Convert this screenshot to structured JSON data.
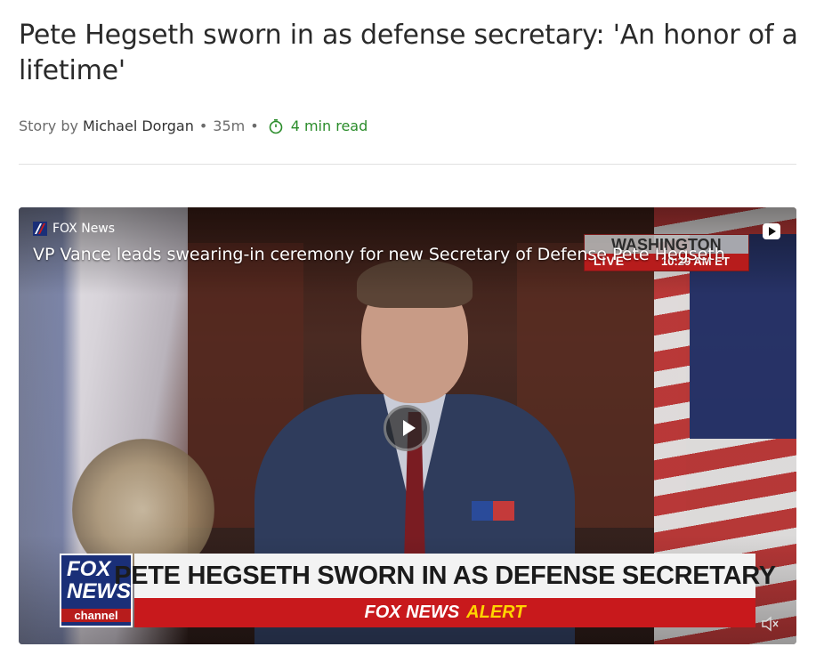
{
  "article": {
    "title": "Pete Hegseth sworn in as defense secretary: 'An honor of a lifetime'",
    "byline_prefix": "Story by",
    "author": "Michael Dorgan",
    "separator": "•",
    "age": "35m",
    "read_time": "4 min read"
  },
  "video": {
    "source": "FOX News",
    "title": "VP Vance leads swearing-in ceremony for new Secretary of Defense Pete Hegseth",
    "bug_city": "WASHINGTON",
    "bug_live": "LIVE",
    "bug_time": "10:29 AM ET",
    "logo_line1": "FOX",
    "logo_line2": "NEWS",
    "logo_line3": "channel",
    "headline": "PETE HEGSETH SWORN IN AS DEFENSE SECRETARY",
    "alert_prefix": "FOX NEWS",
    "alert_word": "ALERT",
    "colors": {
      "alert_red": "#c8191c",
      "fox_blue": "#1a2f78",
      "read_time_green": "#2a8c2a"
    },
    "icons": [
      "fox-news-logo-icon",
      "youtube-icon",
      "play-icon",
      "mute-icon"
    ]
  }
}
